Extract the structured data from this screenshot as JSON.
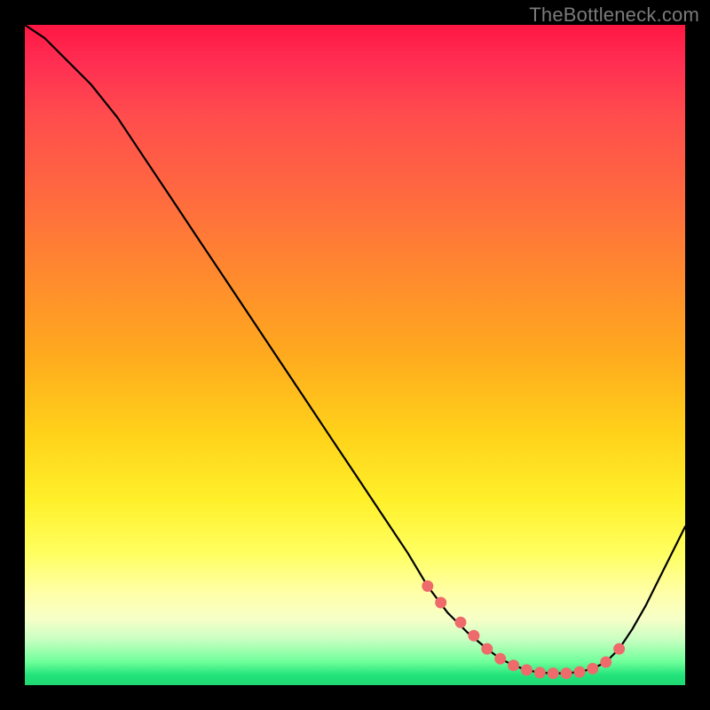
{
  "attribution": "TheBottleneck.com",
  "chart_data": {
    "type": "line",
    "title": "",
    "xlabel": "",
    "ylabel": "",
    "xlim": [
      0,
      100
    ],
    "ylim": [
      0,
      100
    ],
    "grid": false,
    "legend": false,
    "series": [
      {
        "name": "curve",
        "x": [
          0,
          3,
          6,
          10,
          14,
          18,
          22,
          26,
          30,
          34,
          38,
          42,
          46,
          50,
          54,
          58,
          61,
          64,
          67,
          70,
          72,
          74,
          76,
          78,
          80,
          82,
          84,
          86,
          88,
          90,
          92,
          94,
          96,
          100
        ],
        "values": [
          100,
          98,
          95,
          91,
          86,
          80,
          74,
          68,
          62,
          56,
          50,
          44,
          38,
          32,
          26,
          20,
          15,
          11,
          8,
          5.5,
          4,
          3,
          2.3,
          1.9,
          1.8,
          1.8,
          2.0,
          2.5,
          3.5,
          5.5,
          8.5,
          12,
          16,
          24
        ],
        "color": "#000000",
        "stroke_width": 2.2
      }
    ],
    "markers": {
      "name": "trough-points",
      "color": "#ef6b6b",
      "radius": 6.5,
      "x": [
        61,
        63,
        66,
        68,
        70,
        72,
        74,
        76,
        78,
        80,
        82,
        84,
        86,
        88,
        90
      ],
      "values": [
        15,
        12.5,
        9.5,
        7.5,
        5.5,
        4.0,
        3.0,
        2.3,
        1.9,
        1.8,
        1.8,
        2.0,
        2.5,
        3.5,
        5.5
      ]
    }
  }
}
